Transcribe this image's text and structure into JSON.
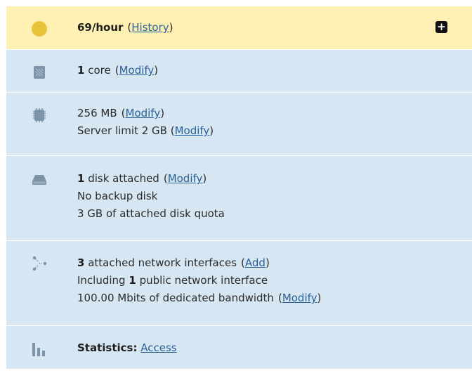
{
  "cost": {
    "rate": "69/hour",
    "history_link": "History",
    "expand_symbol": "+",
    "icon": "coin-icon",
    "icon_color": "#e8c43a"
  },
  "cpu": {
    "count": "1",
    "label": "core",
    "modify_link": "Modify",
    "icon": "cpu-icon"
  },
  "ram": {
    "amount": "256 MB",
    "modify_link": "Modify",
    "limit_text": "Server limit 2 GB",
    "limit_modify_link": "Modify",
    "icon": "memory-chip-icon"
  },
  "disk": {
    "count": "1",
    "label": "disk attached",
    "modify_link": "Modify",
    "backup_text": "No backup disk",
    "quota_text": "3 GB of attached disk quota",
    "icon": "hard-disk-icon"
  },
  "network": {
    "count": "3",
    "label": "attached network interfaces",
    "add_link": "Add",
    "public_prefix": "Including",
    "public_count": "1",
    "public_suffix": "public network interface",
    "bandwidth_text": "100.00 Mbits of dedicated bandwidth",
    "bandwidth_modify_link": "Modify",
    "icon": "network-icon"
  },
  "stats": {
    "label": "Statistics:",
    "access_link": "Access",
    "icon": "bar-chart-icon"
  },
  "colors": {
    "row_bg": "#d6e6f2",
    "highlight_bg": "#fff0b3",
    "icon_gray": "#7d93a8",
    "link": "#2a5f9e"
  }
}
